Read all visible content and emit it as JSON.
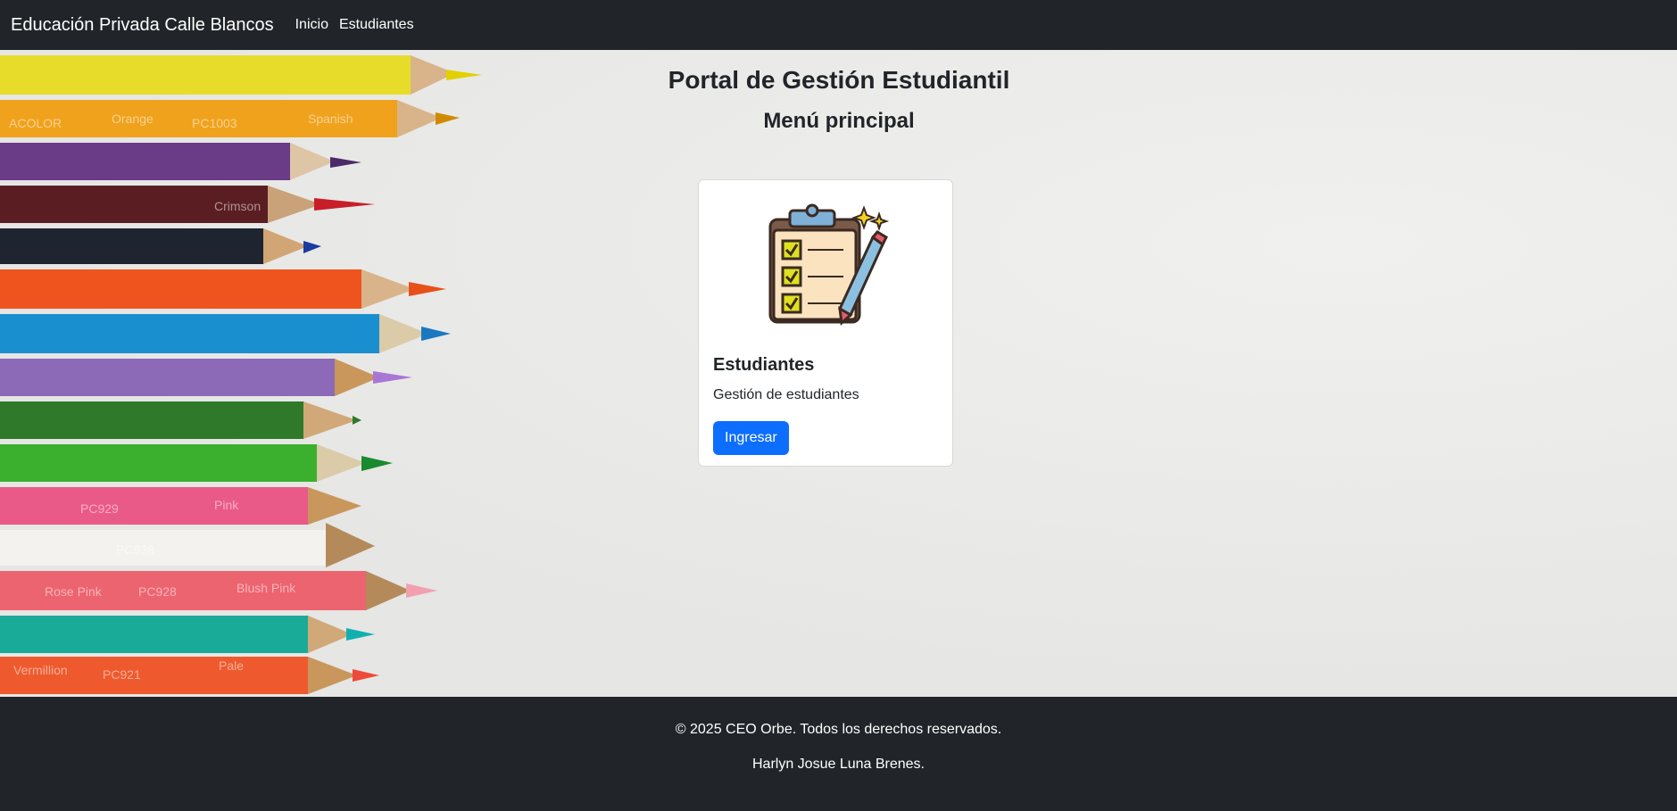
{
  "navbar": {
    "brand": "Educación Privada Calle Blancos",
    "links": [
      "Inicio",
      "Estudiantes"
    ]
  },
  "main": {
    "title": "Portal de Gestión Estudiantil",
    "subtitle": "Menú principal"
  },
  "card": {
    "icon": "clipboard-checklist-icon",
    "title": "Estudiantes",
    "text": "Gestión de estudiantes",
    "button_label": "Ingresar"
  },
  "footer": {
    "copyright": "© 2025 CEO Orbe. Todos los derechos reservados.",
    "author": "Harlyn Josue Luna Brenes."
  },
  "colors": {
    "navbar_bg": "#212529",
    "primary": "#0d6efd",
    "text": "#212529"
  }
}
